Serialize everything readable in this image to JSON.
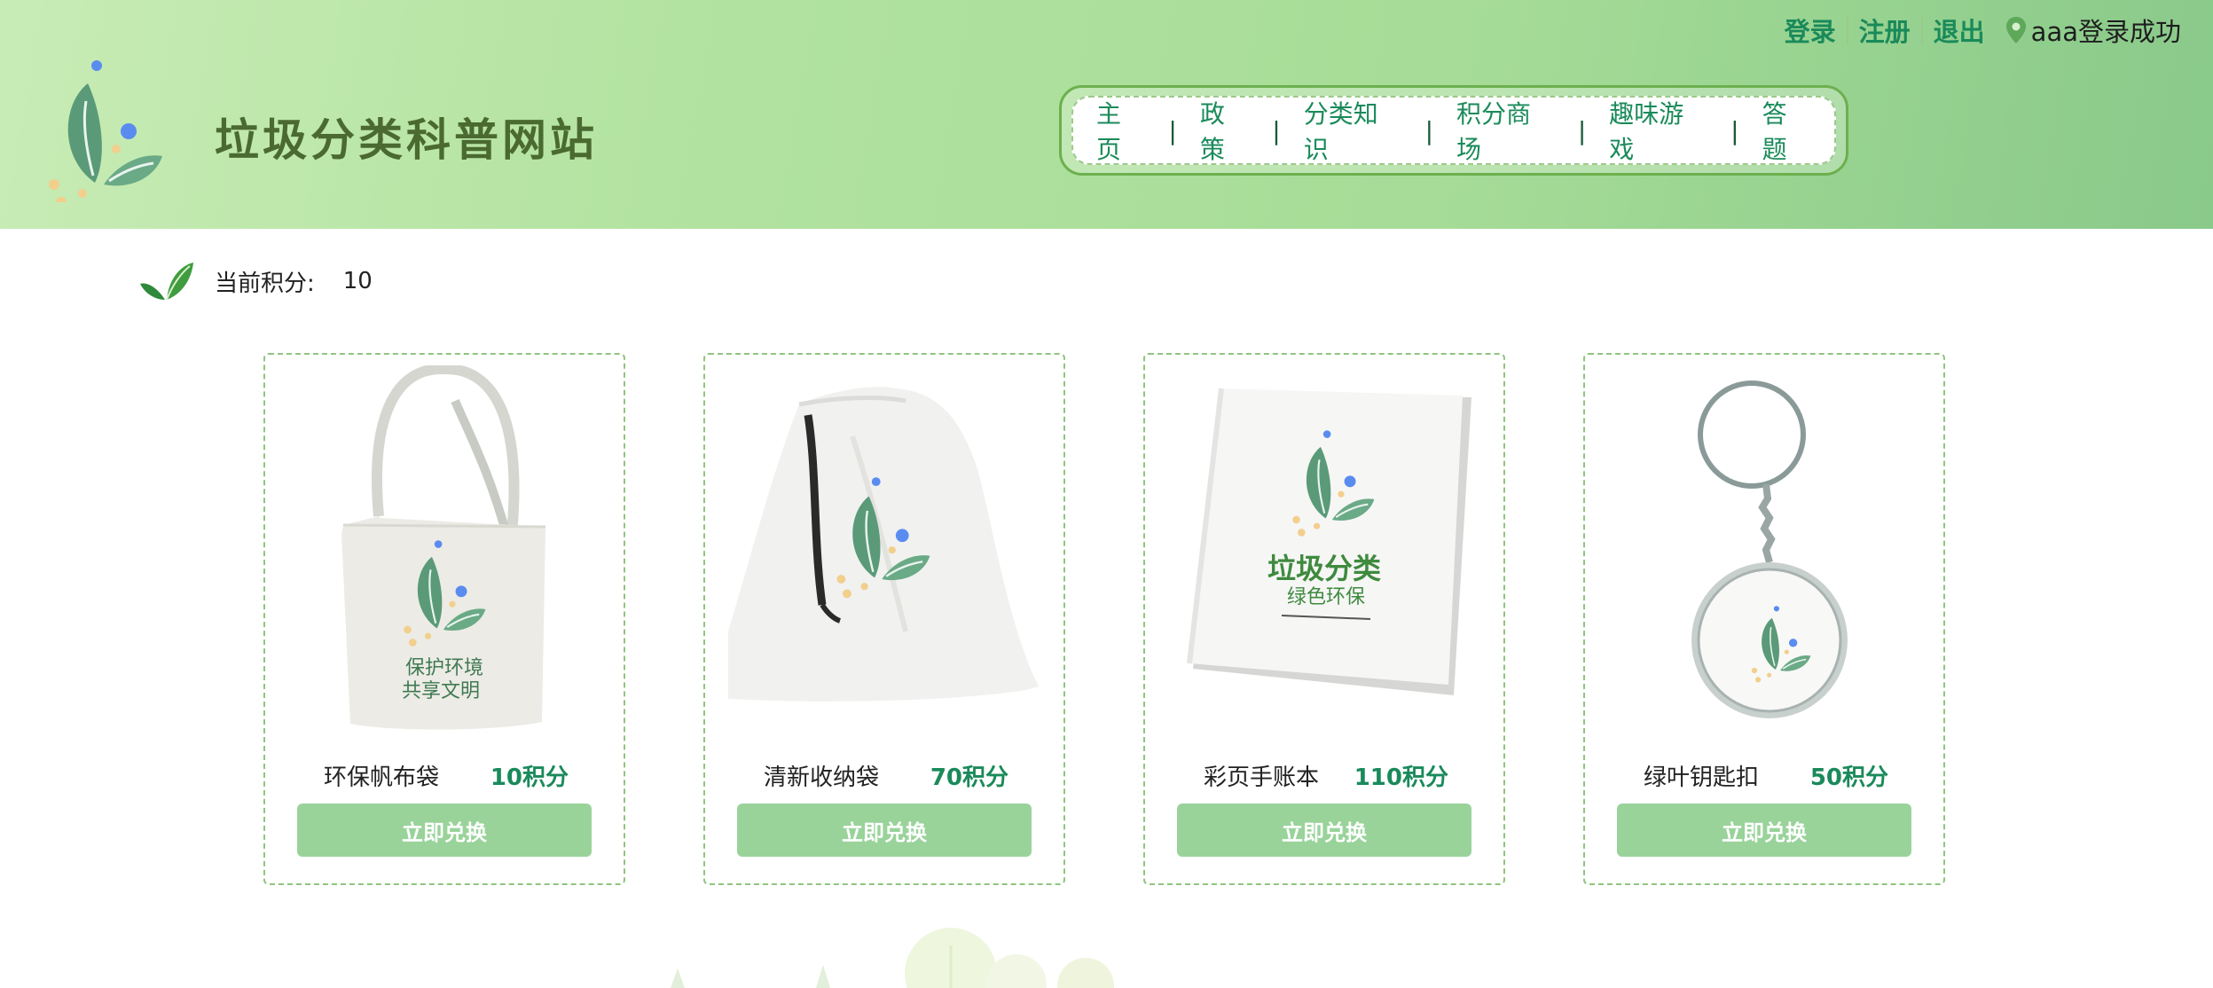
{
  "site": {
    "title": "垃圾分类科普网站",
    "brand_color": "#1a8a5a",
    "header_gradient": [
      "#c8ecb6",
      "#89c98a"
    ]
  },
  "auth": {
    "login": "登录",
    "register": "注册",
    "logout": "退出",
    "status": "aaa登录成功",
    "icon": "location-pin-icon"
  },
  "nav": {
    "items": [
      {
        "label": "主页"
      },
      {
        "label": "政策"
      },
      {
        "label": "分类知识"
      },
      {
        "label": "积分商场"
      },
      {
        "label": "趣味游戏"
      },
      {
        "label": "答题"
      }
    ],
    "separator": "|"
  },
  "points": {
    "label": "当前积分:",
    "value": "10",
    "icon": "leaf-icon"
  },
  "products": [
    {
      "name": "环保帆布袋",
      "price": "10积分",
      "button": "立即兑换",
      "image": "tote-bag-image",
      "image_text": [
        "保护环境",
        "共享文明"
      ]
    },
    {
      "name": "清新收纳袋",
      "price": "70积分",
      "button": "立即兑换",
      "image": "drawstring-bag-image"
    },
    {
      "name": "彩页手账本",
      "price": "110积分",
      "button": "立即兑换",
      "image": "notebook-image",
      "image_text": [
        "垃圾分类",
        "绿色环保"
      ]
    },
    {
      "name": "绿叶钥匙扣",
      "price": "50积分",
      "button": "立即兑换",
      "image": "keychain-image"
    }
  ]
}
